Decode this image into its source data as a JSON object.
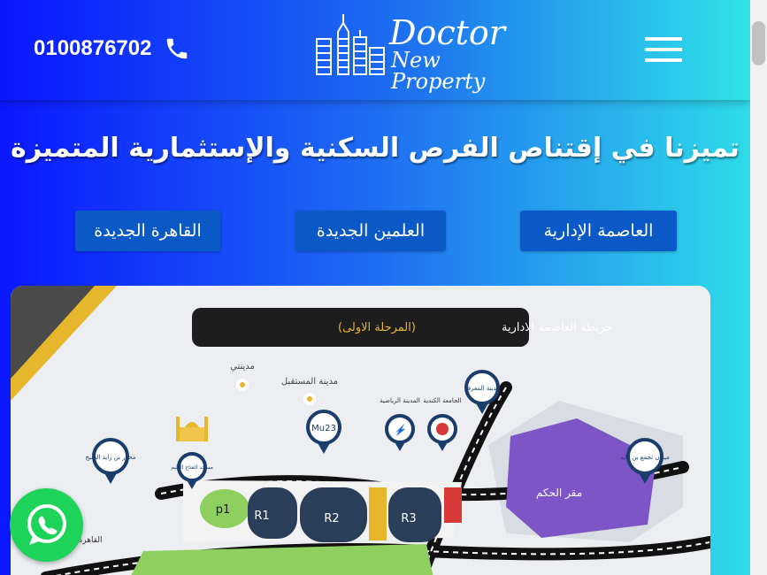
{
  "header": {
    "phone": "0100876702",
    "logo_line1": "Doctor",
    "logo_line2": "New Property"
  },
  "headline": "تميزنا في إقتناص الفرص السكنية والإستثمارية المتميزة",
  "cities": [
    {
      "label": "العاصمة الإدارية"
    },
    {
      "label": "العلمين الجديدة"
    },
    {
      "label": "القاهرة الجديدة"
    }
  ],
  "map": {
    "title": "خريطة العاصمة الادارية",
    "subtitle": "(المرحلة الاولى)",
    "labels": {
      "madinaty": "مدينتي",
      "mostakbal": "مدينة المستقبل",
      "mu23": "Mu23",
      "sports_city": "المدينة الرياضية",
      "university": "الجامعة الكندية",
      "smart_city": "مدينة المعرفة",
      "zayed_axis": "محور بن زايد الشيخ",
      "mosque": "مسجد الفتاح العليم",
      "zayed_square": "ميدان تجمع بن زايد",
      "governance": "مقر الحكم",
      "cairo": "القاهرة",
      "p1": "p1",
      "r1": "R1",
      "r2": "R2",
      "r3": "R3"
    }
  },
  "colors": {
    "brand_blue": "#0a18ff",
    "accent_cyan": "#2fe0e8",
    "button_blue": "#0b59c7",
    "whatsapp_green": "#1ed35a"
  }
}
